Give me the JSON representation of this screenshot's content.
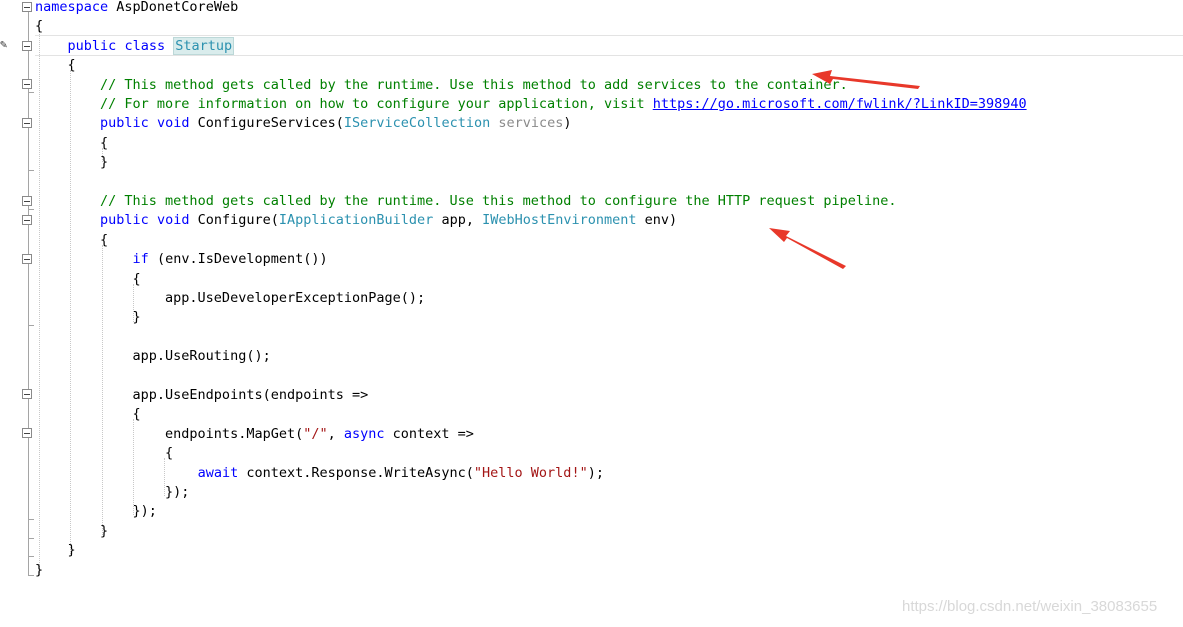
{
  "editor": {
    "lines": [
      [
        {
          "t": "namespace",
          "c": "kw"
        },
        {
          "t": " AspDonetCoreWeb"
        }
      ],
      [
        {
          "t": "{"
        }
      ],
      [
        {
          "t": "    "
        },
        {
          "t": "public",
          "c": "kw"
        },
        {
          "t": " "
        },
        {
          "t": "class",
          "c": "kw"
        },
        {
          "t": " "
        },
        {
          "t": "Startup",
          "c": "ty class-hl"
        }
      ],
      [
        {
          "t": "    {"
        }
      ],
      [
        {
          "t": "        "
        },
        {
          "t": "// This method gets called by the runtime. Use this method to add services to the container.",
          "c": "cm"
        }
      ],
      [
        {
          "t": "        "
        },
        {
          "t": "// For more information on how to configure your application, visit ",
          "c": "cm"
        },
        {
          "t": "https://go.microsoft.com/fwlink/?LinkID=398940",
          "c": "ln"
        }
      ],
      [
        {
          "t": "        "
        },
        {
          "t": "public",
          "c": "kw"
        },
        {
          "t": " "
        },
        {
          "t": "void",
          "c": "kw"
        },
        {
          "t": " ConfigureServices("
        },
        {
          "t": "IServiceCollection",
          "c": "ty"
        },
        {
          "t": " "
        },
        {
          "t": "services",
          "c": "param-dim"
        },
        {
          "t": ")"
        }
      ],
      [
        {
          "t": "        {"
        }
      ],
      [
        {
          "t": "        }"
        }
      ],
      [
        {
          "t": ""
        }
      ],
      [
        {
          "t": "        "
        },
        {
          "t": "// This method gets called by the runtime. Use this method to configure the HTTP request pipeline.",
          "c": "cm"
        }
      ],
      [
        {
          "t": "        "
        },
        {
          "t": "public",
          "c": "kw"
        },
        {
          "t": " "
        },
        {
          "t": "void",
          "c": "kw"
        },
        {
          "t": " Configure("
        },
        {
          "t": "IApplicationBuilder",
          "c": "ty"
        },
        {
          "t": " app, "
        },
        {
          "t": "IWebHostEnvironment",
          "c": "ty"
        },
        {
          "t": " env)"
        }
      ],
      [
        {
          "t": "        {"
        }
      ],
      [
        {
          "t": "            "
        },
        {
          "t": "if",
          "c": "kw"
        },
        {
          "t": " (env.IsDevelopment())"
        }
      ],
      [
        {
          "t": "            {"
        }
      ],
      [
        {
          "t": "                app.UseDeveloperExceptionPage();"
        }
      ],
      [
        {
          "t": "            }"
        }
      ],
      [
        {
          "t": ""
        }
      ],
      [
        {
          "t": "            app.UseRouting();"
        }
      ],
      [
        {
          "t": ""
        }
      ],
      [
        {
          "t": "            app.UseEndpoints(endpoints =>"
        }
      ],
      [
        {
          "t": "            {"
        }
      ],
      [
        {
          "t": "                endpoints.MapGet("
        },
        {
          "t": "\"/\"",
          "c": "str"
        },
        {
          "t": ", "
        },
        {
          "t": "async",
          "c": "kw"
        },
        {
          "t": " context =>"
        }
      ],
      [
        {
          "t": "                {"
        }
      ],
      [
        {
          "t": "                    "
        },
        {
          "t": "await",
          "c": "kw"
        },
        {
          "t": " context.Response.WriteAsync("
        },
        {
          "t": "\"Hello World!\"",
          "c": "str"
        },
        {
          "t": ");"
        }
      ],
      [
        {
          "t": "                });"
        }
      ],
      [
        {
          "t": "            });"
        }
      ],
      [
        {
          "t": "        }"
        }
      ],
      [
        {
          "t": "    }"
        }
      ],
      [
        {
          "t": "}"
        }
      ]
    ]
  },
  "watermark": "https://blog.csdn.net/weixin_38083655",
  "colors": {
    "keyword": "#0000ff",
    "type": "#2b91af",
    "comment": "#008000",
    "string": "#a31515",
    "arrow": "#e8382a"
  }
}
